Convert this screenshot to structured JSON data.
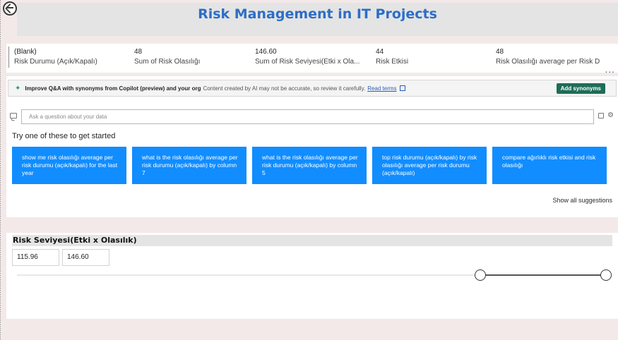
{
  "title": "Risk Management in IT Projects",
  "cards": [
    {
      "value": "(Blank)",
      "label": "Risk Durumu (Açık/Kapalı)"
    },
    {
      "value": "48",
      "label": "Sum of Risk Olasılığı"
    },
    {
      "value": "146.60",
      "label": "Sum of Risk Seviyesi(Etki x Ola..."
    },
    {
      "value": "44",
      "label": "Risk Etkisi"
    },
    {
      "value": "48",
      "label": "Risk Olasılığı average per Risk D"
    }
  ],
  "more_options": "...",
  "qa": {
    "banner": {
      "bold": "Improve Q&A with synonyms from Copilot (preview) and your org",
      "note": "Content created by AI may not be accurate, so review it carefully.",
      "link": "Read terms",
      "button": "Add synonyms",
      "close": "✕"
    },
    "ask_placeholder": "Ask a question about your data",
    "try_label": "Try one of these to get started",
    "suggestions": [
      "show me risk olasılığı average per risk durumu (açık/kapalı) for the last year",
      "what is the risk olasılığı average per risk durumu (açık/kapalı) by column 7",
      "what is the risk olasılığı average per risk durumu (açık/kapalı) by column 5",
      "top risk durumu (açık/kapalı) by risk olasılığı average per risk durumu (açık/kapalı)",
      "compare ağırlıklı risk etkisi and risk olasılığı"
    ],
    "show_all": "Show all suggestions"
  },
  "slicer": {
    "title": "Risk Seviyesi(Etki x Olasılık)",
    "min": "115.96",
    "max": "146.60",
    "selected_start_fraction": 0.785,
    "selected_end_fraction": 1.0
  },
  "colors": {
    "title": "#2c6ec6",
    "suggestion": "#118dff",
    "add_button": "#1e6d56",
    "canvas": "#f3e9e9"
  },
  "icons": [
    "app-logo-icon",
    "sparkle-icon",
    "external-link-icon",
    "close-icon",
    "chat-icon",
    "settings-icon",
    "more-icon"
  ]
}
